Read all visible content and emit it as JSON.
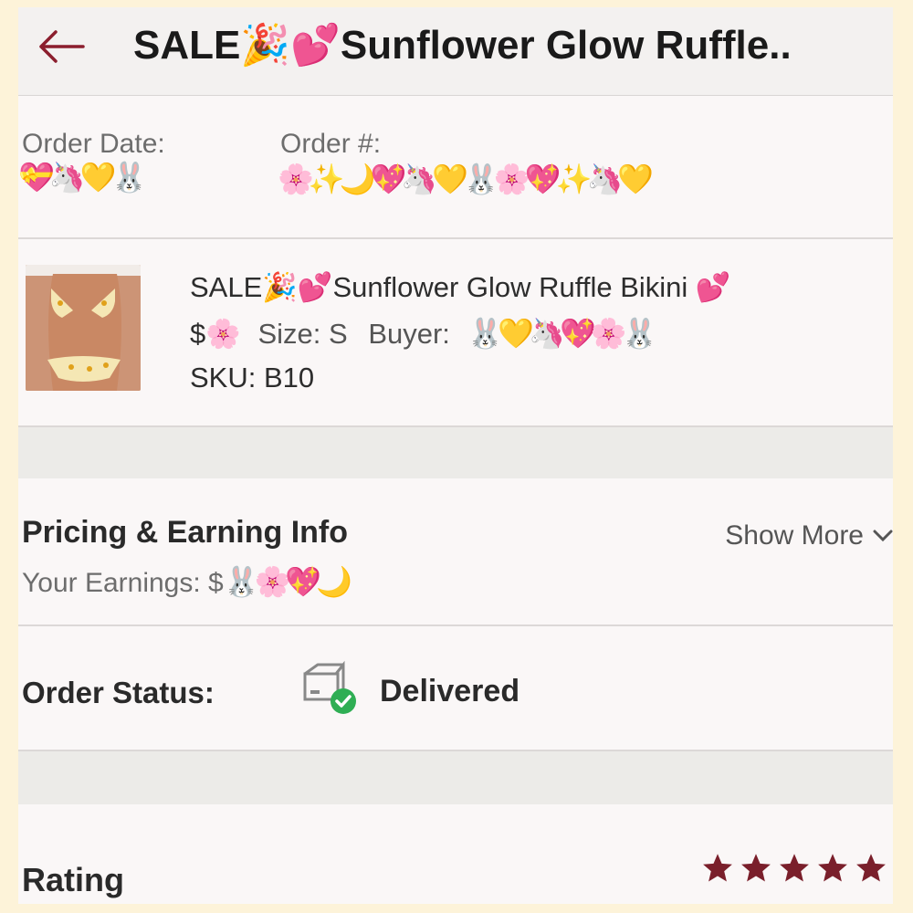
{
  "header": {
    "title": "SALE🎉💕Sunflower Glow Ruffle.."
  },
  "order": {
    "date_label": "Order Date:",
    "date_value": "💝🦄💛🐰",
    "number_label": "Order #:",
    "number_value": "🌸✨🌙💖🦄💛🐰🌸💖✨🦄💛"
  },
  "product": {
    "title": "SALE🎉💕Sunflower Glow Ruffle Bikini 💕",
    "price_prefix": "$🌸",
    "size": "Size: S",
    "buyer_label": "Buyer:",
    "buyer_value": "🐰💛🦄💖🌸🐰",
    "sku": "SKU: B10"
  },
  "pricing": {
    "heading": "Pricing & Earning Info",
    "show_more": "Show More",
    "earnings_label": "Your Earnings: $",
    "earnings_value": "🐰🌸💖🌙"
  },
  "status": {
    "label": "Order Status:",
    "value": "Delivered"
  },
  "rating": {
    "label": "Rating",
    "stars": 5,
    "star_color": "#7a1f2b"
  },
  "colors": {
    "accent": "#8b1e2d",
    "status_check": "#2fae54"
  }
}
